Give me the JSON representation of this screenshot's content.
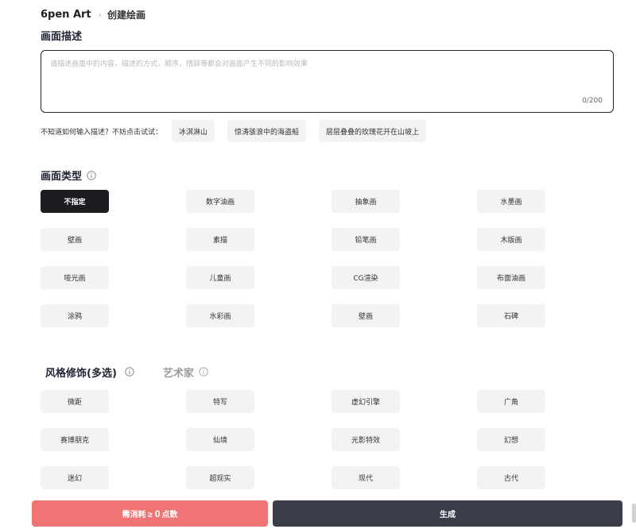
{
  "breadcrumb": {
    "app": "6pen Art",
    "separator": "›",
    "page": "创建绘画"
  },
  "description": {
    "title": "画面描述",
    "placeholder": "请描述画面中的内容，描述的方式，顺序，措辞等都会对画面产生不同的影响效果",
    "value": "",
    "counter": "0/200"
  },
  "hints": {
    "prompt": "不知道如何输入描述？不妨点击试试：",
    "examples": [
      "冰淇淋山",
      "惊涛骇浪中的海盗船",
      "层层叠叠的玫瑰花开在山坡上"
    ]
  },
  "picture_type": {
    "title": "画面类型",
    "options": [
      "不指定",
      "数字油画",
      "抽象画",
      "水墨画",
      "壁画",
      "素描",
      "铅笔画",
      "木版画",
      "哑光画",
      "儿童画",
      "CG渲染",
      "布面油画",
      "涂鸦",
      "水彩画",
      "壁画",
      "石碑"
    ],
    "selected_index": 0
  },
  "style_tabs": {
    "style": "风格修饰(多选)",
    "artist": "艺术家"
  },
  "style_options": [
    "微距",
    "特写",
    "虚幻引擎",
    "广角",
    "赛博朋克",
    "仙境",
    "光影特效",
    "幻想",
    "迷幻",
    "超现实",
    "现代",
    "古代"
  ],
  "footer": {
    "cost_prefix": "需消耗 ≥",
    "cost_value": "0",
    "cost_suffix": "点数",
    "generate": "生成"
  },
  "colors": {
    "accent_dark": "#1d1d21",
    "cost_button": "#f07474",
    "generate_button": "#3a3e49",
    "chip_bg": "#f2f3f5"
  }
}
